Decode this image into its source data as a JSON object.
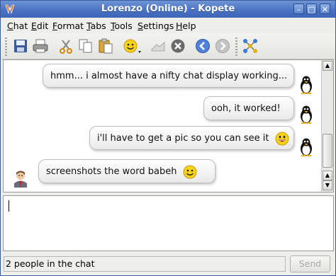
{
  "window": {
    "title": "Lorenzo (Online) - Kopete",
    "app_icon": "kopete-icon",
    "controls": {
      "minimize": "minimize-icon",
      "maximize": "maximize-icon",
      "close": "close-icon"
    },
    "accent_color": "#4a73c4"
  },
  "menubar": {
    "items": [
      {
        "key": "C",
        "rest": "hat"
      },
      {
        "key": "E",
        "rest": "dit"
      },
      {
        "key": "F",
        "rest": "ormat"
      },
      {
        "key": "T",
        "rest": "abs"
      },
      {
        "key": "T",
        "rest": "ools"
      },
      {
        "key": "S",
        "rest": "ettings"
      },
      {
        "key": "H",
        "rest": "elp"
      }
    ]
  },
  "toolbar": {
    "buttons": [
      "save-icon",
      "print-icon",
      "cut-icon",
      "copy-icon",
      "paste-icon",
      "smiley-icon",
      "send-file-icon",
      "stop-icon",
      "back-icon",
      "forward-icon",
      "network-icon"
    ]
  },
  "chat": {
    "messages": [
      {
        "direction": "outgoing",
        "text": "hmm... i almost have a nifty chat display working...",
        "has_smiley": false,
        "avatar": "penguin-avatar"
      },
      {
        "direction": "outgoing",
        "text": "ooh, it worked!",
        "has_smiley": false,
        "avatar": "penguin-avatar"
      },
      {
        "direction": "outgoing",
        "text": "i'll have to get a pic so you can see it",
        "has_smiley": true,
        "smiley": "grin-smiley",
        "avatar": "penguin-avatar"
      },
      {
        "direction": "incoming",
        "text": "screenshots the word babeh",
        "has_smiley": true,
        "smiley": "smile-smiley",
        "avatar": "person-avatar"
      }
    ]
  },
  "input": {
    "value": ""
  },
  "statusbar": {
    "text": "2 people in the chat",
    "send_label": "Send",
    "send_enabled": false
  }
}
